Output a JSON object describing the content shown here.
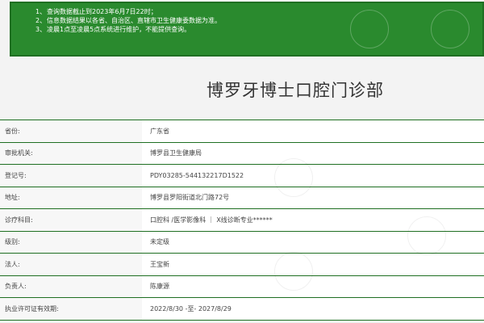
{
  "notice": {
    "lines": [
      {
        "num": "1、",
        "text": "查询数据截止到2023年6月7日22时；"
      },
      {
        "num": "2、",
        "text": "信息数据结果以各省、自治区、直辖市卫生健康委数据为准。"
      },
      {
        "num": "3、",
        "text": "凌晨1点至凌晨5点系统进行维护，不能提供查询。"
      }
    ]
  },
  "page_title": "博罗牙博士口腔门诊部",
  "details": {
    "rows": [
      {
        "label": "省份:",
        "value": "广东省"
      },
      {
        "label": "审批机关:",
        "value": "博罗县卫生健康局"
      },
      {
        "label": "登记号:",
        "value": "PDY03285-544132217D1522"
      },
      {
        "label": "地址:",
        "value": "博罗县罗阳街道北门路72号"
      },
      {
        "label": "诊疗科目:",
        "value": "口腔科 /医学影像科 ｜ X线诊断专业******"
      },
      {
        "label": "级别:",
        "value": "未定级"
      },
      {
        "label": "法人:",
        "value": "王宝新"
      },
      {
        "label": "负责人:",
        "value": "陈康源"
      },
      {
        "label": "执业许可证有效期:",
        "value": "2022/8/30 -至- 2027/8/29"
      }
    ]
  },
  "colors": {
    "notice_bg": "#2a8a2e",
    "row_border": "#1f6f22"
  }
}
